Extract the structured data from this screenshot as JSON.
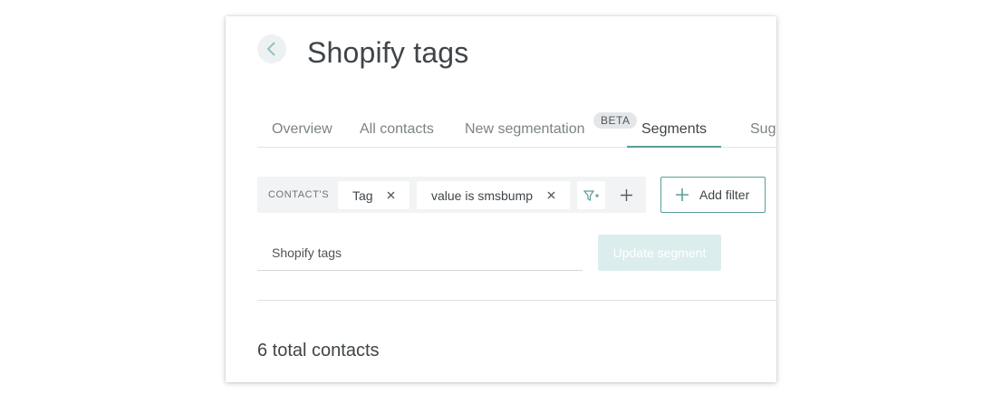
{
  "header": {
    "title": "Shopify tags",
    "back_icon": "chevron-left-icon"
  },
  "tabs": [
    {
      "label": "Overview",
      "active": false
    },
    {
      "label": "All contacts",
      "active": false
    },
    {
      "label": "New segmentation",
      "active": false,
      "badge": "BETA"
    },
    {
      "label": "Segments",
      "active": true
    },
    {
      "label": "Sugg",
      "active": false
    }
  ],
  "filter": {
    "prefix": "CONTACT'S",
    "chips": [
      {
        "label": "Tag"
      },
      {
        "label": "value is smsbump"
      }
    ],
    "add_condition_icon": "filter-plus-icon",
    "add_group_icon": "plus-icon",
    "add_filter_label": "Add filter"
  },
  "segment": {
    "name_value": "Shopify tags",
    "update_label": "Update segment"
  },
  "summary": {
    "total_label": "6 total contacts"
  },
  "colors": {
    "accent": "#5b9e98",
    "disabled_button": "#dcedee",
    "filter_bar": "#f1f3f4"
  }
}
